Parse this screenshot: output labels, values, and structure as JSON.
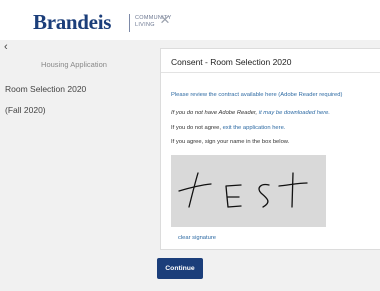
{
  "header": {
    "logo_text": "Brandeis",
    "logo_subtitle_line1": "COMMUNITY",
    "logo_subtitle_line2": "LIVING",
    "close_glyph": "×"
  },
  "sidebar": {
    "back_glyph": "‹",
    "heading": "Housing Application",
    "items": [
      {
        "label": "Room Selection 2020"
      },
      {
        "label": "(Fall 2020)"
      }
    ]
  },
  "card": {
    "title": "Consent - Room Selection 2020",
    "review_text": "Please review the contract available here (Adobe Reader required)",
    "no_reader_text": "If you do not have Adobe Reader, ",
    "no_reader_link": "it may be downloaded here.",
    "disagree_text": "If you do not agree, ",
    "disagree_link": "exit the application here.",
    "agree_text": "If you agree, sign your name in the box below.",
    "signature_value": "test",
    "clear_signature_label": "clear signature"
  },
  "continue_label": "Continue",
  "colors": {
    "brand": "#1b3e7a",
    "link": "#2d6aa3",
    "panel_bg": "#f1f1f1",
    "signature_bg": "#d9d9d9"
  },
  "icons": {
    "close": "close-icon",
    "back": "chevron-left-icon"
  }
}
